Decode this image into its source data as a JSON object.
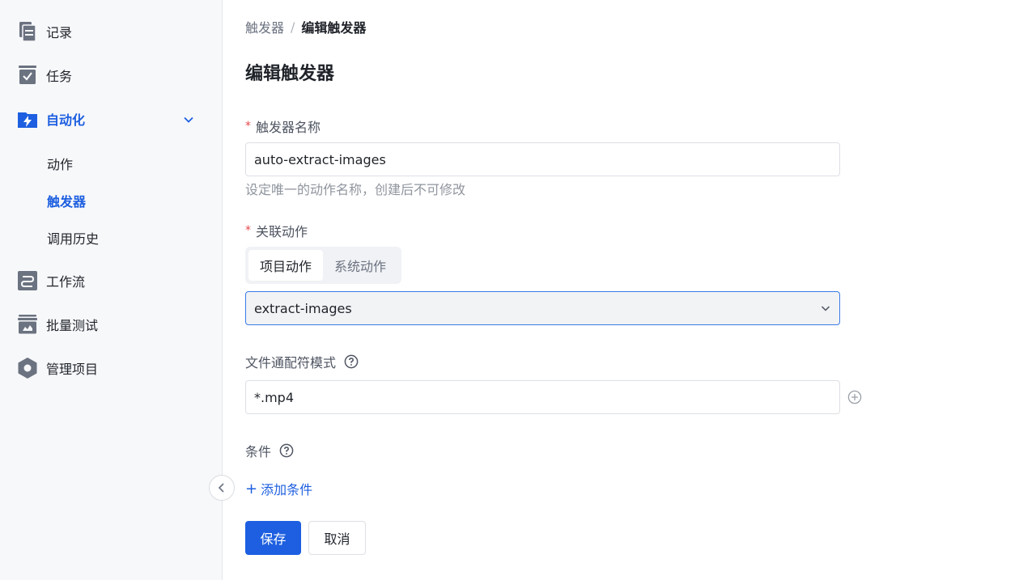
{
  "sidebar": {
    "items": [
      {
        "label": "记录",
        "icon": "records-icon"
      },
      {
        "label": "任务",
        "icon": "tasks-icon"
      },
      {
        "label": "自动化",
        "icon": "automation-icon",
        "expanded": true
      },
      {
        "label": "工作流",
        "icon": "workflow-icon"
      },
      {
        "label": "批量测试",
        "icon": "batch-test-icon"
      },
      {
        "label": "管理项目",
        "icon": "manage-project-icon"
      }
    ],
    "sub_items": [
      {
        "label": "动作"
      },
      {
        "label": "触发器",
        "active": true
      },
      {
        "label": "调用历史"
      }
    ],
    "collapse_icon": "chevron-left-icon"
  },
  "breadcrumb": {
    "parent": "触发器",
    "separator": "/",
    "current": "编辑触发器"
  },
  "page_title": "编辑触发器",
  "form": {
    "name": {
      "label": "触发器名称",
      "required_mark": "*",
      "value": "auto-extract-images",
      "hint": "设定唯一的动作名称，创建后不可修改"
    },
    "action": {
      "label": "关联动作",
      "required_mark": "*",
      "tabs": [
        {
          "label": "项目动作",
          "active": true
        },
        {
          "label": "系统动作",
          "active": false
        }
      ],
      "selected": "extract-images"
    },
    "pattern": {
      "label": "文件通配符模式",
      "value": "*.mp4"
    },
    "conditions": {
      "label": "条件",
      "add_plus": "+",
      "add_label": "添加条件"
    }
  },
  "buttons": {
    "save": "保存",
    "cancel": "取消"
  },
  "colors": {
    "accent": "#1d5fe0",
    "sidebar_bg": "#f7f8fa",
    "required": "#e5484d",
    "icon_gray": "#6b7280"
  }
}
